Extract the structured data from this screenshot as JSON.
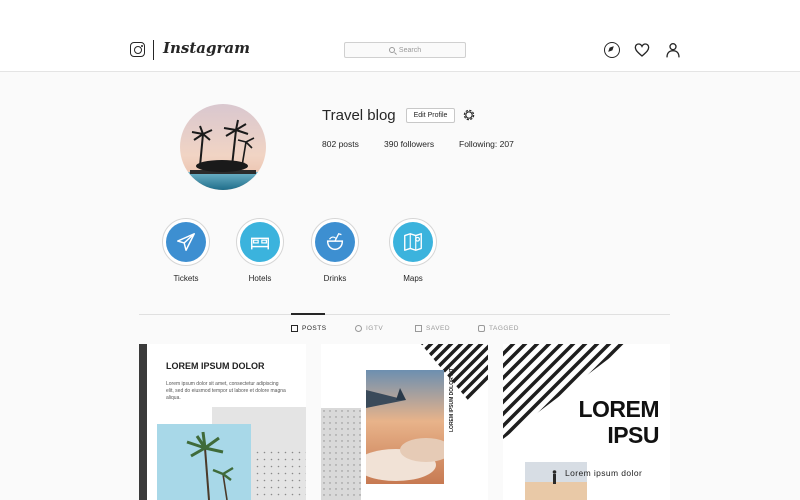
{
  "header": {
    "brand": "Instagram",
    "search_placeholder": "Search",
    "icons": [
      "instagram-glyph-icon",
      "compass-icon",
      "heart-icon",
      "user-icon"
    ]
  },
  "profile": {
    "name": "Travel blog",
    "edit_button": "Edit Profile",
    "posts_count": "802",
    "posts_label": "posts",
    "followers_count": "390",
    "followers_label": "followers",
    "following_label": "Following:",
    "following_count": "207"
  },
  "highlights": [
    {
      "label": "Tickets",
      "icon": "airplane-icon",
      "color": "#3d8fd1"
    },
    {
      "label": "Hotels",
      "icon": "bed-icon",
      "color": "#3bb3dd"
    },
    {
      "label": "Drinks",
      "icon": "coconut-drink-icon",
      "color": "#3d8fd1"
    },
    {
      "label": "Maps",
      "icon": "map-pin-icon",
      "color": "#3bb3dd"
    }
  ],
  "tabs": [
    {
      "label": "POSTS",
      "active": true
    },
    {
      "label": "IGTV",
      "active": false
    },
    {
      "label": "SAVED",
      "active": false
    },
    {
      "label": "TAGGED",
      "active": false
    }
  ],
  "posts": {
    "p1": {
      "title": "LOREM IPSUM DOLOR",
      "body": "Lorem ipsum dolor sit amet, consectetur adipiscing elit, sed do eiusmod tempor ut labore et dolore magna aliqua."
    },
    "p2": {
      "vertical_text": "LOREM IPSUM DOLOR SIT"
    },
    "p3": {
      "big_line1": "LOREM",
      "big_line2": "IPSU",
      "subtitle": "Lorem ipsum dolor"
    }
  },
  "colors": {
    "accent_blue": "#3d8fd1",
    "accent_cyan": "#3bb3dd",
    "text": "#262626",
    "background": "#fafafa"
  }
}
